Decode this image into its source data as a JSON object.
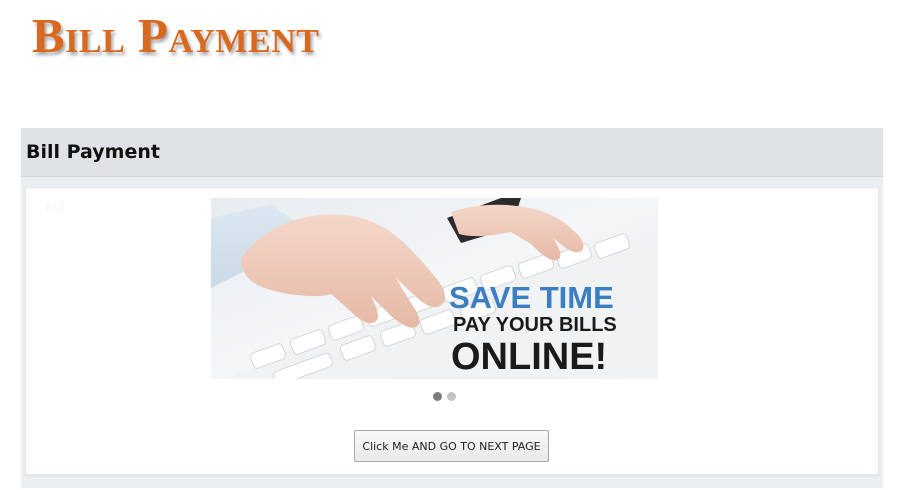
{
  "page": {
    "title": "Bill Payment",
    "title_color": "#d9691e"
  },
  "panel": {
    "header_title": "Bill Payment",
    "header_bg": "#dfe2e6"
  },
  "carousel": {
    "counter": "1 / 2",
    "slide": {
      "line1": "SAVE TIME",
      "line2": "PAY YOUR BILLS",
      "line3": "ONLINE!",
      "line1_color": "#3a7fc4",
      "line23_color": "#1a1a1a",
      "icons": [
        "keyboard-icon",
        "typing-hands-icon"
      ]
    },
    "dots": [
      {
        "active": true
      },
      {
        "active": false
      }
    ]
  },
  "actions": {
    "next_button_label": "Click Me AND GO TO NEXT PAGE"
  }
}
